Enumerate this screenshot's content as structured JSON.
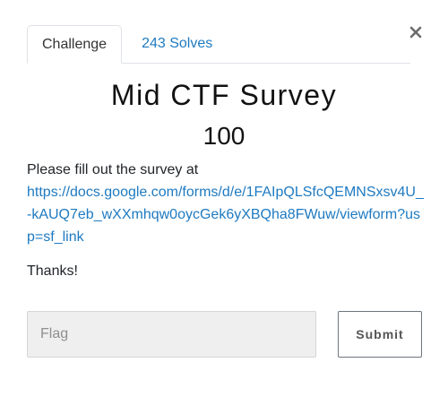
{
  "tabs": [
    {
      "label": "Challenge",
      "active": true
    },
    {
      "label": "243 Solves",
      "active": false
    }
  ],
  "challenge": {
    "name": "Mid CTF Survey",
    "value": "100",
    "description_prefix": "Please fill out the survey at",
    "link": "https://docs.google.com/forms/d/e/1FAIpQLSfcQEMNSxsv4U_-kAUQ7eb_wXXmhqw0oycGek6yXBQha8FWuw/viewform?usp=sf_link",
    "closing": "Thanks!"
  },
  "form": {
    "flag_placeholder": "Flag",
    "flag_value": "",
    "submit_label": "Submit"
  },
  "icons": {
    "close": "close-icon"
  },
  "colors": {
    "link": "#1e7ac1",
    "input_bg": "#efefef",
    "border": "#dee2e6"
  }
}
